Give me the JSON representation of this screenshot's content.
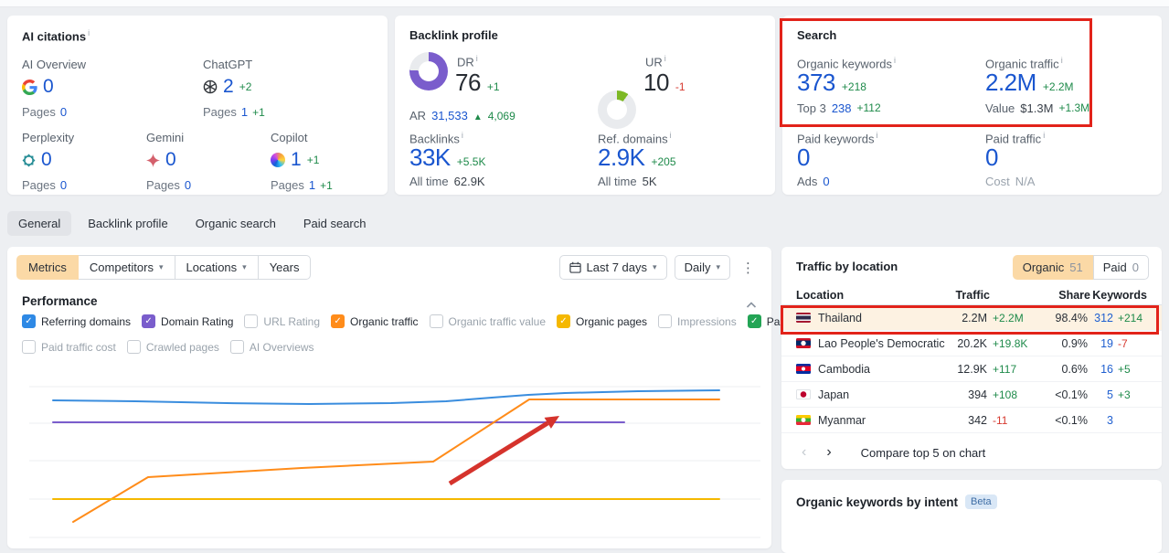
{
  "colors": {
    "accent_orange": "#fbd9a6",
    "annotation_red": "#e2231a",
    "link_blue": "#1a56cf",
    "delta_green": "#1e8a4a",
    "delta_red": "#d6392f"
  },
  "cards": {
    "ai_citations": {
      "title": "AI citations",
      "items": [
        {
          "label": "AI Overview",
          "icon": "google-logo",
          "value": "0",
          "delta": "",
          "pages_label": "Pages",
          "pages": "0",
          "pages_delta": ""
        },
        {
          "label": "ChatGPT",
          "icon": "chatgpt-logo",
          "value": "2",
          "delta": "+2",
          "pages_label": "Pages",
          "pages": "1",
          "pages_delta": "+1"
        },
        {
          "label": "Perplexity",
          "icon": "perplexity-logo",
          "value": "0",
          "delta": "",
          "pages_label": "Pages",
          "pages": "0",
          "pages_delta": ""
        },
        {
          "label": "Gemini",
          "icon": "gemini-logo",
          "value": "0",
          "delta": "",
          "pages_label": "Pages",
          "pages": "0",
          "pages_delta": ""
        },
        {
          "label": "Copilot",
          "icon": "copilot-logo",
          "value": "1",
          "delta": "+1",
          "pages_label": "Pages",
          "pages": "1",
          "pages_delta": "+1"
        }
      ]
    },
    "backlink_profile": {
      "title": "Backlink profile",
      "dr": {
        "label": "DR",
        "value": "76",
        "delta": "+1",
        "percent": 76,
        "color": "#7a5dcc"
      },
      "ar": {
        "label": "AR",
        "value": "31,533",
        "delta": "4,069"
      },
      "ur": {
        "label": "UR",
        "value": "10",
        "delta": "-1",
        "percent": 10,
        "color": "#7cb824"
      },
      "backlinks": {
        "label": "Backlinks",
        "value": "33K",
        "delta": "+5.5K",
        "alltime_label": "All time",
        "alltime": "62.9K"
      },
      "ref_domains": {
        "label": "Ref. domains",
        "value": "2.9K",
        "delta": "+205",
        "alltime_label": "All time",
        "alltime": "5K"
      }
    },
    "search": {
      "title": "Search",
      "organic_keywords": {
        "label": "Organic keywords",
        "value": "373",
        "delta": "+218",
        "sub_label": "Top 3",
        "sub_value": "238",
        "sub_delta": "+112"
      },
      "organic_traffic": {
        "label": "Organic traffic",
        "value": "2.2M",
        "delta": "+2.2M",
        "sub_label": "Value",
        "sub_value": "$1.3M",
        "sub_delta": "+1.3M"
      },
      "paid_keywords": {
        "label": "Paid keywords",
        "value": "0",
        "sub_label": "Ads",
        "sub_value": "0"
      },
      "paid_traffic": {
        "label": "Paid traffic",
        "value": "0",
        "sub_label": "Cost",
        "sub_value": "N/A"
      }
    }
  },
  "tabs": [
    {
      "label": "General"
    },
    {
      "label": "Backlink profile"
    },
    {
      "label": "Organic search"
    },
    {
      "label": "Paid search"
    }
  ],
  "toolbar": {
    "metrics": "Metrics",
    "competitors": "Competitors",
    "locations": "Locations",
    "years": "Years",
    "date_range": "Last 7 days",
    "granularity": "Daily"
  },
  "performance": {
    "title": "Performance",
    "checkboxes": [
      {
        "label": "Referring domains",
        "checked": true,
        "color": "#2e89e5"
      },
      {
        "label": "Domain Rating",
        "checked": true,
        "color": "#7a5dcc"
      },
      {
        "label": "URL Rating",
        "checked": false,
        "color": ""
      },
      {
        "label": "Organic traffic",
        "checked": true,
        "color": "#ff8c1a"
      },
      {
        "label": "Organic traffic value",
        "checked": false,
        "color": ""
      },
      {
        "label": "Organic pages",
        "checked": true,
        "color": "#f5b800"
      },
      {
        "label": "Impressions",
        "checked": false,
        "color": ""
      },
      {
        "label": "Paid traffic",
        "checked": true,
        "color": "#23a455"
      },
      {
        "label": "Paid traffic cost",
        "checked": false,
        "color": ""
      },
      {
        "label": "Crawled pages",
        "checked": false,
        "color": ""
      },
      {
        "label": "AI Overviews",
        "checked": false,
        "color": ""
      }
    ]
  },
  "chart_data": {
    "type": "line",
    "title": "Performance",
    "axes_visible": false,
    "note": "axis labels cropped out of screenshot; points are panel pixel coordinates",
    "gridlines_y": [
      18,
      58,
      99,
      141,
      183
    ],
    "series": [
      {
        "name": "Referring domains",
        "color": "#3a8dde",
        "points": [
          [
            50,
            33
          ],
          [
            140,
            34
          ],
          [
            240,
            36
          ],
          [
            330,
            37
          ],
          [
            420,
            36
          ],
          [
            480,
            34
          ],
          [
            530,
            30
          ],
          [
            570,
            27
          ],
          [
            610,
            25
          ],
          [
            690,
            23
          ],
          [
            779,
            22
          ]
        ]
      },
      {
        "name": "Domain Rating",
        "color": "#7a5dcc",
        "points": [
          [
            50,
            57
          ],
          [
            675,
            57
          ]
        ]
      },
      {
        "name": "Organic traffic",
        "color": "#ff8c1a",
        "points": [
          [
            72,
            166
          ],
          [
            154,
            117
          ],
          [
            322,
            107
          ],
          [
            466,
            100
          ],
          [
            571,
            32
          ],
          [
            779,
            32
          ]
        ]
      },
      {
        "name": "Organic pages",
        "color": "#f5b800",
        "points": [
          [
            50,
            141
          ],
          [
            779,
            141
          ]
        ]
      }
    ],
    "annotation_arrow": {
      "from": [
        484,
        124
      ],
      "to": [
        604,
        50
      ],
      "color": "#d5332c"
    }
  },
  "traffic_by_location": {
    "title": "Traffic by location",
    "toggle": [
      {
        "label": "Organic",
        "count": "51"
      },
      {
        "label": "Paid",
        "count": "0"
      }
    ],
    "columns": [
      "Location",
      "Traffic",
      "Share",
      "Keywords"
    ],
    "rows": [
      {
        "country": "Thailand",
        "traffic": "2.2M",
        "traffic_delta": "+2.2M",
        "share": "98.4%",
        "keywords": "312",
        "keywords_delta": "+214"
      },
      {
        "country": "Lao People's Democratic Reput",
        "traffic": "20.2K",
        "traffic_delta": "+19.8K",
        "share": "0.9%",
        "keywords": "19",
        "keywords_delta": "-7"
      },
      {
        "country": "Cambodia",
        "traffic": "12.9K",
        "traffic_delta": "+117",
        "share": "0.6%",
        "keywords": "16",
        "keywords_delta": "+5"
      },
      {
        "country": "Japan",
        "traffic": "394",
        "traffic_delta": "+108",
        "share": "<0.1%",
        "keywords": "5",
        "keywords_delta": "+3"
      },
      {
        "country": "Myanmar",
        "traffic": "342",
        "traffic_delta": "-11",
        "share": "<0.1%",
        "keywords": "3",
        "keywords_delta": ""
      }
    ],
    "footer_link": "Compare top 5 on chart"
  },
  "intent_panel": {
    "title": "Organic keywords by intent",
    "badge": "Beta"
  }
}
